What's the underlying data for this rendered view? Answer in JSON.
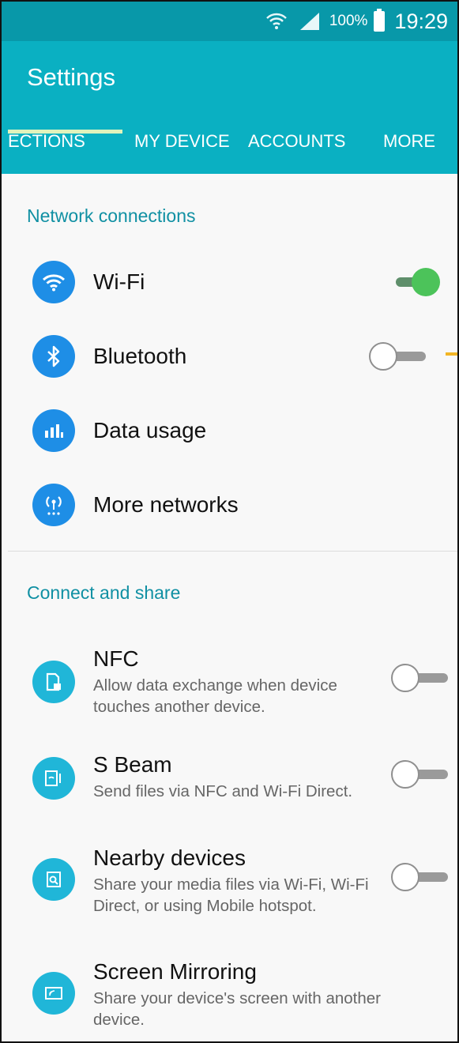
{
  "status_bar": {
    "battery_percent": "100%",
    "time": "19:29",
    "icons": [
      "wifi-icon",
      "signal-icon",
      "battery-icon"
    ]
  },
  "app_bar": {
    "title": "Settings",
    "tabs": [
      {
        "label": "ECTIONS",
        "selected": true
      },
      {
        "label": "MY DEVICE",
        "selected": false
      },
      {
        "label": "ACCOUNTS",
        "selected": false
      },
      {
        "label": "MORE",
        "selected": false
      }
    ]
  },
  "sections": {
    "network": {
      "header": "Network connections",
      "items": [
        {
          "label": "Wi-Fi",
          "icon": "wifi-icon",
          "toggle": true
        },
        {
          "label": "Bluetooth",
          "icon": "bluetooth-icon",
          "toggle": false
        },
        {
          "label": "Data usage",
          "icon": "bar-chart-icon"
        },
        {
          "label": "More networks",
          "icon": "antenna-icon"
        }
      ]
    },
    "connect": {
      "header": "Connect and share",
      "items": [
        {
          "label": "NFC",
          "sub": "Allow data exchange when device touches another device.",
          "icon": "nfc-icon",
          "toggle": false
        },
        {
          "label": "S Beam",
          "sub": "Send files via NFC and Wi-Fi Direct.",
          "icon": "s-beam-icon",
          "toggle": false
        },
        {
          "label": "Nearby devices",
          "sub": "Share your media files via Wi-Fi, Wi-Fi Direct, or using Mobile hotspot.",
          "icon": "nearby-devices-icon",
          "toggle": false
        },
        {
          "label": "Screen Mirroring",
          "sub": "Share your device's screen with another device.",
          "icon": "screen-mirroring-icon"
        }
      ]
    }
  },
  "colors": {
    "status_bar": "#0898a9",
    "app_bar": "#0ab0c2",
    "accent_text": "#1090a3",
    "toggle_on": "#4cc35a",
    "annotation_arrow": "#f2b524"
  }
}
